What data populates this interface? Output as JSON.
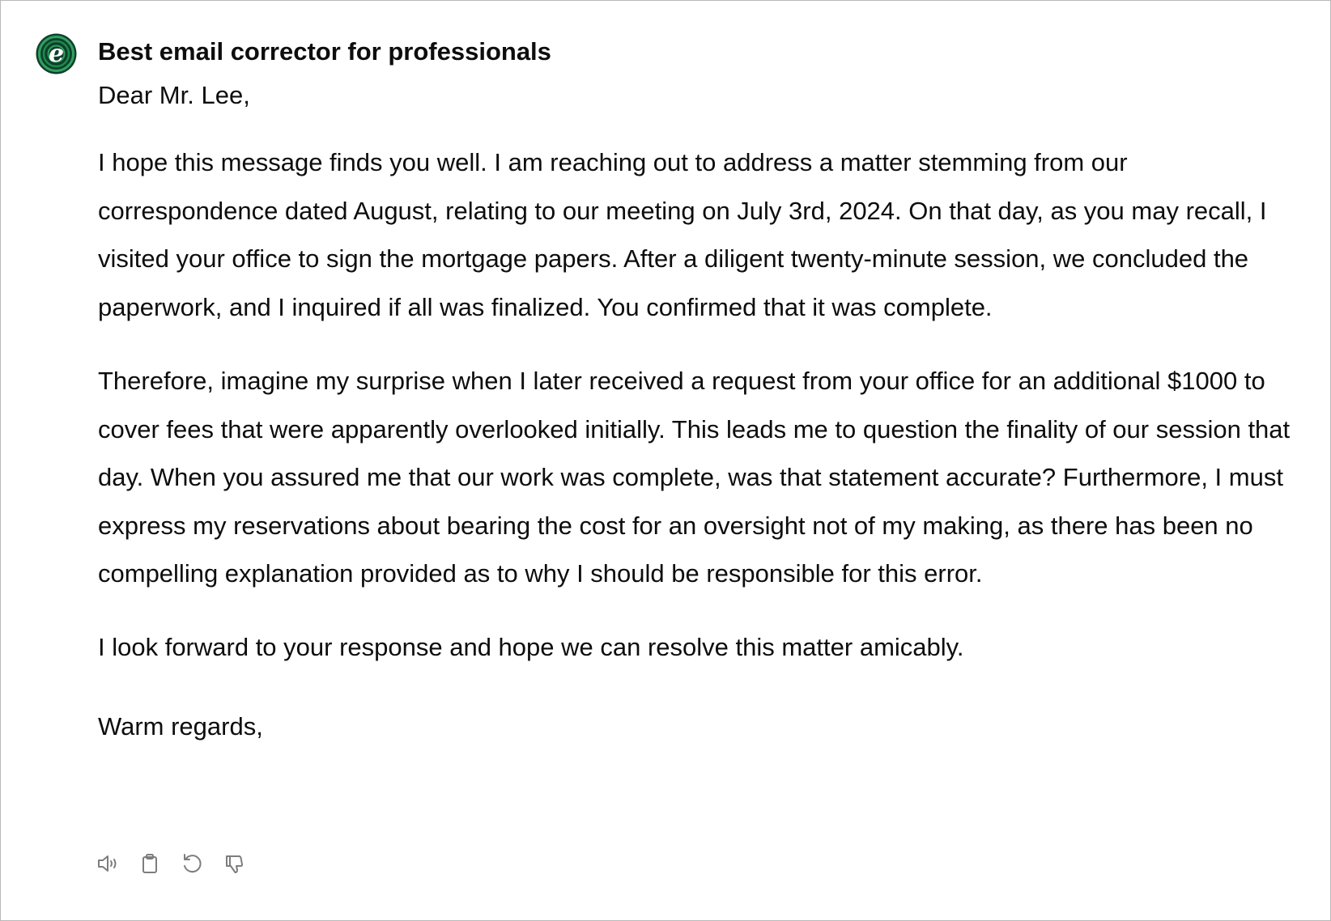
{
  "gpt": {
    "name": "Best email corrector for professionals",
    "avatar_icon": "green-e-logo-icon",
    "avatar_colors": {
      "ring": "#1e8a4a",
      "inner": "#0f3f2d",
      "letter": "#ffffff"
    }
  },
  "email": {
    "salutation": "Dear Mr. Lee,",
    "paragraphs": [
      "I hope this message finds you well. I am reaching out to address a matter stemming from our correspondence dated August, relating to our meeting on July 3rd, 2024. On that day, as you may recall, I visited your office to sign the mortgage papers. After a diligent twenty-minute session, we concluded the paperwork, and I inquired if all was finalized. You confirmed that it was complete.",
      "Therefore, imagine my surprise when I later received a request from your office for an additional $1000 to cover fees that were apparently overlooked initially. This leads me to question the finality of our session that day. When you assured me that our work was complete, was that statement accurate? Furthermore, I must express my reservations about bearing the cost for an oversight not of my making, as there has been no compelling explanation provided as to why I should be responsible for this error.",
      "I look forward to your response and hope we can resolve this matter amicably."
    ],
    "closing": "Warm regards,"
  },
  "actions": [
    {
      "icon": "speaker-icon",
      "name": "read-aloud-button"
    },
    {
      "icon": "clipboard-icon",
      "name": "copy-button"
    },
    {
      "icon": "refresh-icon",
      "name": "regenerate-button"
    },
    {
      "icon": "thumbs-down-icon",
      "name": "bad-response-button"
    }
  ],
  "colors": {
    "text": "#0d0d0d",
    "icon": "#7d7d7d",
    "border": "#b9b9b9"
  }
}
